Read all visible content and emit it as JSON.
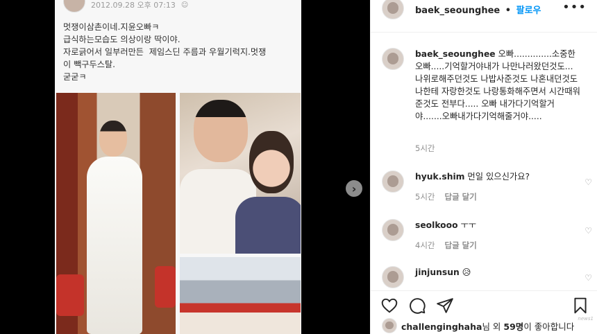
{
  "post_card": {
    "date": "2012.09.28 오후 07:13",
    "text": "멋쟁이삼촌이네.지윤오빠ㅋ\n급식하는모습도 의상이랑 딱이야.\n자로긁어서 일부러만든  제임스딘 주름과 우월기럭지.멋쟁\n이 빽구두스탈.\n굳굳ㅋ"
  },
  "header": {
    "username": "baek_seounghee",
    "separator": "•",
    "follow_label": "팔로우",
    "more_label": "•••"
  },
  "caption": {
    "username": "baek_seounghee",
    "text": "오빠..............소중한오빠.....기억할거야내가 나만나러왔던것도...나위로해주던것도 나밥사준것도 나혼내던것도 나한테 자랑한것도 나랑통화해주면서 시간때워준것도 전부다..... 오빠 내가다기억할거야.......오빠내가다기억해줄거야.....",
    "time": "5시간"
  },
  "comments": [
    {
      "username": "hyuk.shim",
      "text": "먼일 있으신가요?",
      "time": "5시간",
      "reply_label": "답글 달기"
    },
    {
      "username": "seolkooo",
      "text": "ㅜㅜ",
      "time": "4시간",
      "reply_label": "답글 달기"
    },
    {
      "username": "jinjunsun",
      "text": "😥",
      "time": "",
      "reply_label": ""
    }
  ],
  "likes": {
    "username": "challenginghaha",
    "middle": "님 외",
    "count": "59명",
    "suffix": "이 좋아합니다"
  },
  "icons": {
    "like": "heart-icon",
    "comment": "comment-icon",
    "share": "share-icon",
    "save": "bookmark-icon",
    "next": "chevron-right-icon"
  },
  "colors": {
    "follow": "#0095f6",
    "meta": "#8e8e8e"
  },
  "watermark": "news1"
}
